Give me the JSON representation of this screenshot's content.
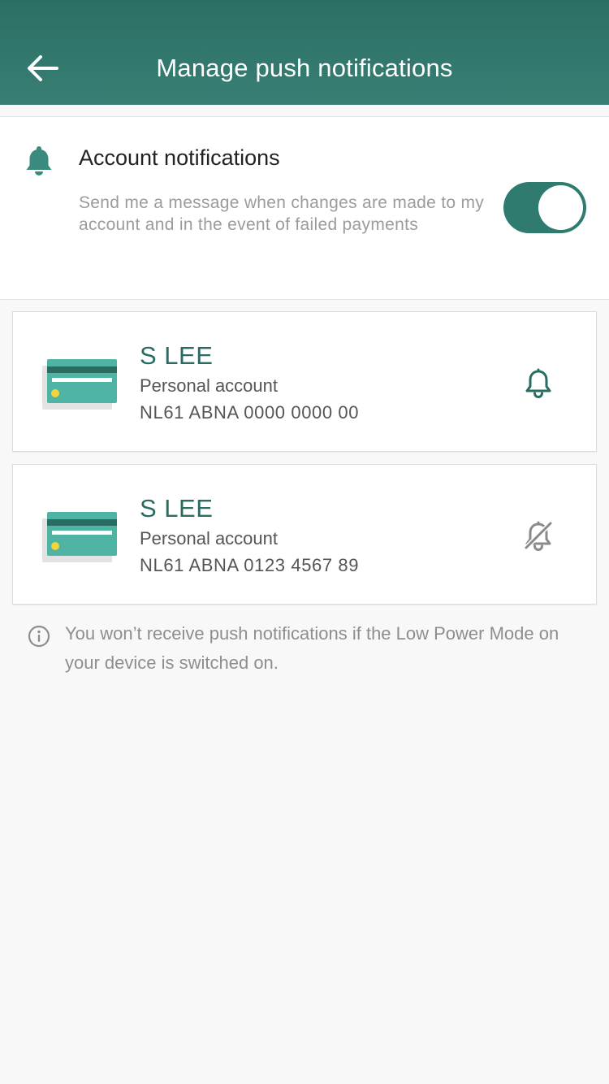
{
  "header": {
    "title": "Manage push notifications",
    "back_icon": "arrow-left-icon"
  },
  "account_notifications": {
    "icon": "bell-icon",
    "title": "Account notifications",
    "description": "Send me a message when changes are made to my account and in the event of failed payments",
    "toggle_on": true
  },
  "accounts": [
    {
      "name": "S LEE",
      "type": "Personal account",
      "iban": "NL61 ABNA 0000 0000 00",
      "notification_icon": "bell-icon",
      "notifications_on": true
    },
    {
      "name": "S LEE",
      "type": "Personal account",
      "iban": "NL61 ABNA 0123 4567 89",
      "notification_icon": "bell-off-icon",
      "notifications_on": false
    }
  ],
  "info": {
    "icon": "info-icon",
    "text": "You won’t receive push notifications if the Low Power Mode on your device is switched on."
  },
  "colors": {
    "header_bg": "#2f7469",
    "accent": "#2f7b70",
    "card_teal": "#4fb4a4",
    "card_dark": "#2a6b62",
    "card_chip": "#f2d43b"
  }
}
